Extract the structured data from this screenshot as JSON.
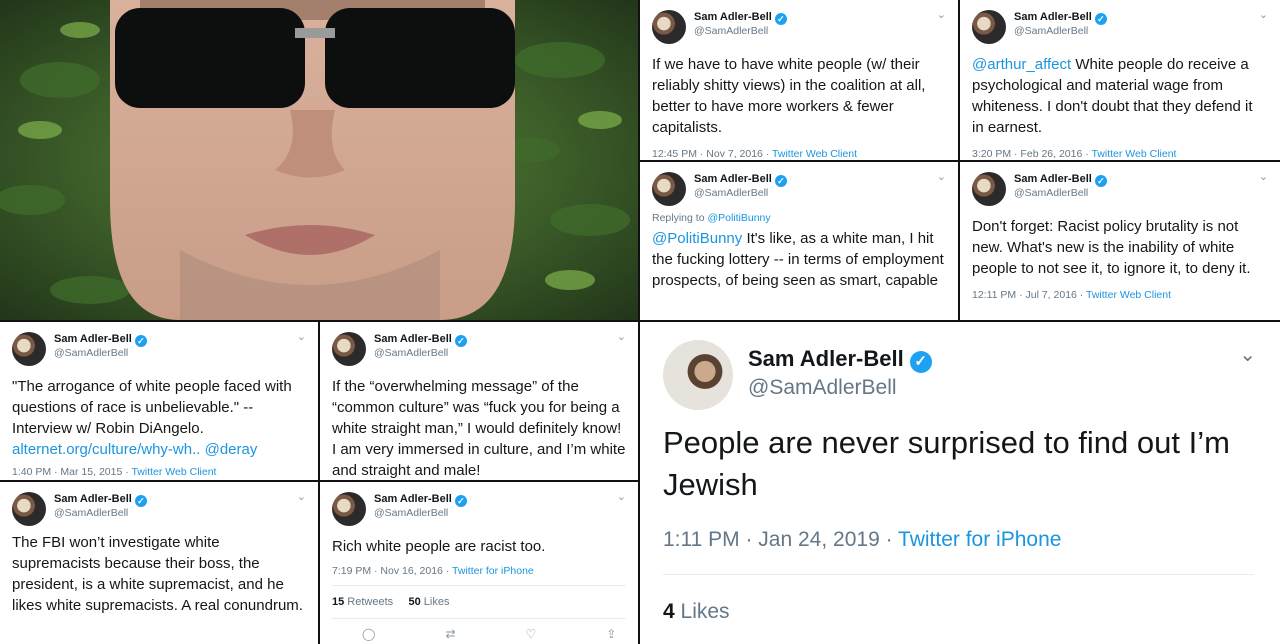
{
  "tweets": [
    {
      "name": "Sam Adler-Bell",
      "handle": "@SamAdlerBell",
      "text": "If we have to have white people (w/ their reliably shitty views) in the coalition at all, better to have more workers & fewer capitalists.",
      "time": "12:45 PM · Nov 7, 2016 · ",
      "source": "Twitter Web Client"
    },
    {
      "name": "Sam Adler-Bell",
      "handle": "@SamAdlerBell",
      "mention": "@arthur_affect",
      "text": " White people do receive a psychological and material wage from whiteness. I don't doubt that they defend it in earnest.",
      "time": "3:20 PM · Feb 26, 2016 · ",
      "source": "Twitter Web Client"
    },
    {
      "name": "Sam Adler-Bell",
      "handle": "@SamAdlerBell",
      "reply_prefix": "Replying to ",
      "reply_to": "@PolitiBunny",
      "mention": "@PolitiBunny",
      "text": " It's like, as a white man, I hit the fucking lottery -- in terms of employment prospects, of being seen as smart, capable"
    },
    {
      "name": "Sam Adler-Bell",
      "handle": "@SamAdlerBell",
      "text": "Don't forget: Racist policy brutality is not new. What's new is the inability of white people to not see it, to ignore it, to deny it.",
      "time": "12:11 PM · Jul 7, 2016 · ",
      "source": "Twitter Web Client"
    },
    {
      "name": "Sam Adler-Bell",
      "handle": "@SamAdlerBell",
      "text": "\"The arrogance of white people faced with questions of race is unbelievable.\" -- Interview w/ Robin DiAngelo.",
      "link": "alternet.org/culture/why-wh..",
      "mention": " @deray",
      "time": "1:40 PM · Mar 15, 2015 · ",
      "source": "Twitter Web Client"
    },
    {
      "name": "Sam Adler-Bell",
      "handle": "@SamAdlerBell",
      "text": "If the “overwhelming message” of the “common culture” was “fuck you for being a white straight man,” I would definitely know! I am very immersed in culture, and I’m white and straight and male!"
    },
    {
      "name": "Sam Adler-Bell",
      "handle": "@SamAdlerBell",
      "text": "The FBI won’t investigate white supremacists because their boss, the president, is a white supremacist, and he likes white supremacists. A real conundrum."
    },
    {
      "name": "Sam Adler-Bell",
      "handle": "@SamAdlerBell",
      "text": "Rich white people are racist too.",
      "time": "7:19 PM · Nov 16, 2016 · ",
      "source": "Twitter for iPhone",
      "retweets": "15",
      "retweets_label": " Retweets",
      "likes": "50",
      "likes_label": " Likes"
    }
  ],
  "big_tweet": {
    "name": "Sam Adler-Bell",
    "handle": "@SamAdlerBell",
    "text": "People are never surprised to find out I’m Jewish",
    "time": "1:11 PM · Jan 24, 2019 · ",
    "source": "Twitter for iPhone",
    "likes": "4",
    "likes_label": " Likes"
  },
  "icons": {
    "verified": "✓",
    "chevron": "⌄",
    "reply": "◯",
    "retweet": "⇄",
    "like": "♡",
    "share": "⇪"
  }
}
